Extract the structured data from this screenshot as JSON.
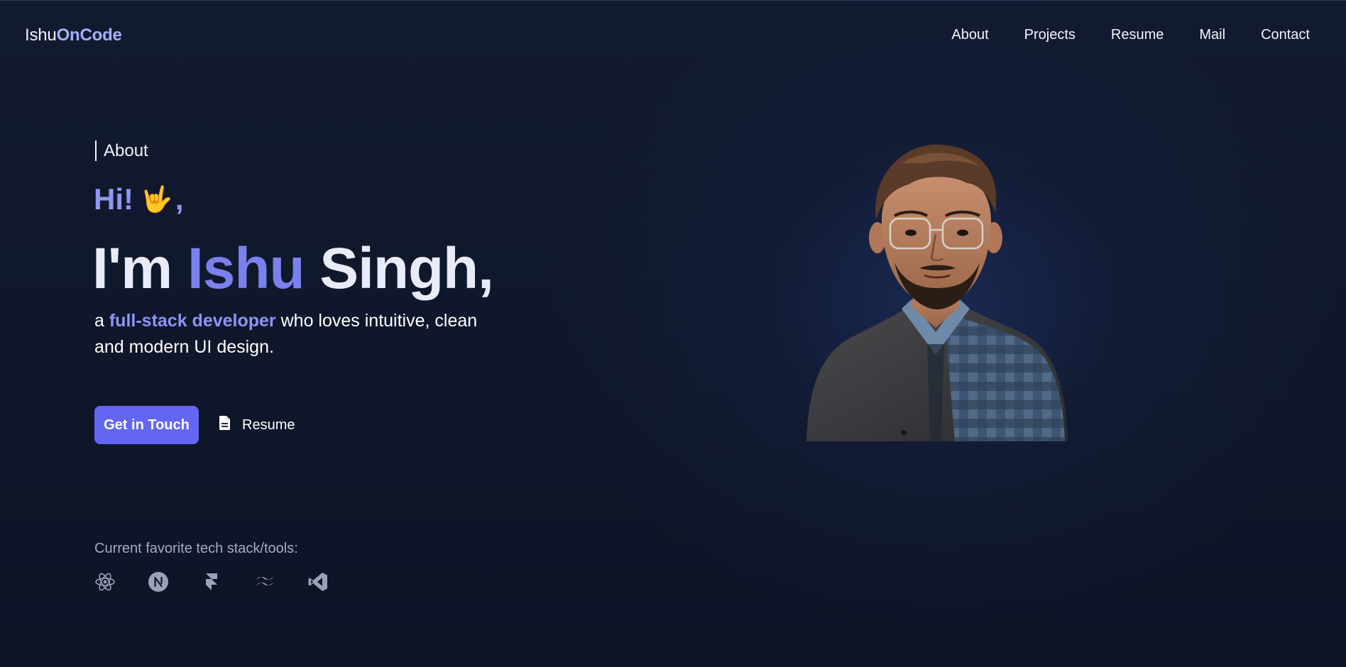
{
  "header": {
    "logo_part1": "Ishu",
    "logo_part2": "OnCode",
    "nav": [
      {
        "label": "About"
      },
      {
        "label": "Projects"
      },
      {
        "label": "Resume"
      },
      {
        "label": "Mail"
      },
      {
        "label": "Contact"
      }
    ]
  },
  "hero": {
    "eyebrow": "About",
    "greeting": "Hi!",
    "greeting_emoji": "🤟",
    "greeting_suffix": ",",
    "name_prefix": "I'm",
    "name_first": "Ishu",
    "name_last": "Singh,",
    "tagline_prefix": "a",
    "tagline_highlight": "full-stack developer",
    "tagline_rest": "who loves intuitive, clean and modern UI design.",
    "cta_primary": "Get in Touch",
    "cta_secondary": "Resume"
  },
  "tools": {
    "label": "Current favorite tech stack/tools:",
    "items": [
      {
        "icon": "react-icon"
      },
      {
        "icon": "nextjs-icon"
      },
      {
        "icon": "framer-icon"
      },
      {
        "icon": "tailwind-icon"
      },
      {
        "icon": "vscode-icon"
      }
    ]
  },
  "colors": {
    "background": "#0f1526",
    "accent": "#6366f1",
    "accent_text": "#7b80ee",
    "muted_text": "#a4abc0"
  }
}
